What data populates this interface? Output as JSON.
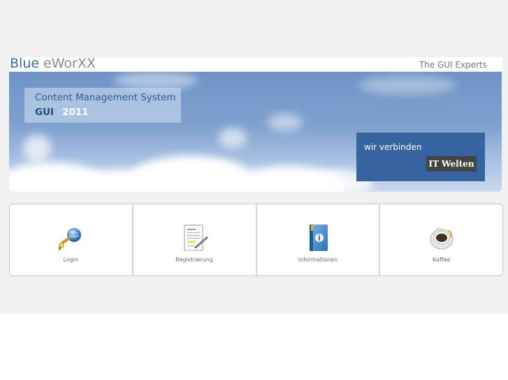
{
  "header": {
    "logo_primary": "Blue",
    "logo_secondary": "eWorXX",
    "tagline": "The GUI Experts"
  },
  "banner": {
    "cms_title": "Content Management System",
    "cms_gui": "GUI",
    "cms_year": "2011",
    "connect_text": "wir verbinden",
    "it_welten_label": "IT Welten"
  },
  "tiles": [
    {
      "label": "Login",
      "icon": "key-globe-icon"
    },
    {
      "label": "Registrierung",
      "icon": "document-pen-icon"
    },
    {
      "label": "Informationen",
      "icon": "info-book-icon"
    },
    {
      "label": "Kaffee",
      "icon": "coffee-cup-icon"
    }
  ],
  "colors": {
    "brand_blue": "#3a6ea5",
    "box_blue": "#3564a0",
    "page_grey": "#f0f0f0"
  }
}
